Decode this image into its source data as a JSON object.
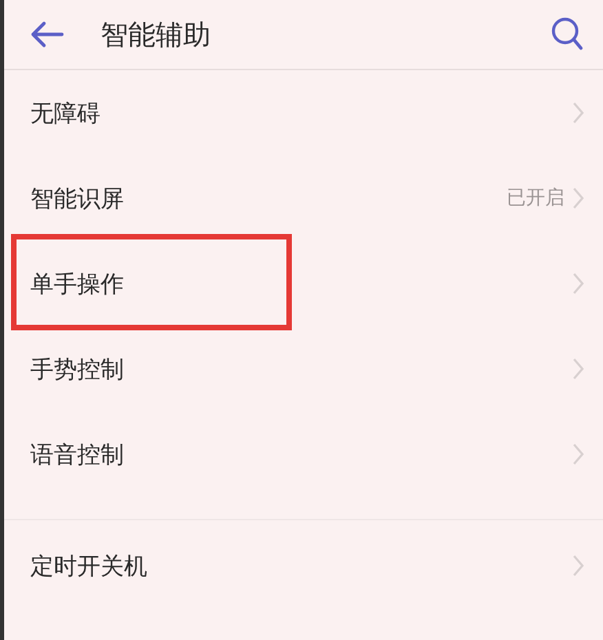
{
  "header": {
    "title": "智能辅助"
  },
  "sections": [
    {
      "items": [
        {
          "label": "无障碍",
          "highlighted": false
        },
        {
          "label": "智能识屏",
          "value": "已开启",
          "highlighted": false
        },
        {
          "label": "单手操作",
          "highlighted": true
        },
        {
          "label": "手势控制",
          "highlighted": false
        },
        {
          "label": "语音控制",
          "highlighted": false
        }
      ]
    },
    {
      "items": [
        {
          "label": "定时开关机",
          "highlighted": false
        }
      ]
    }
  ]
}
